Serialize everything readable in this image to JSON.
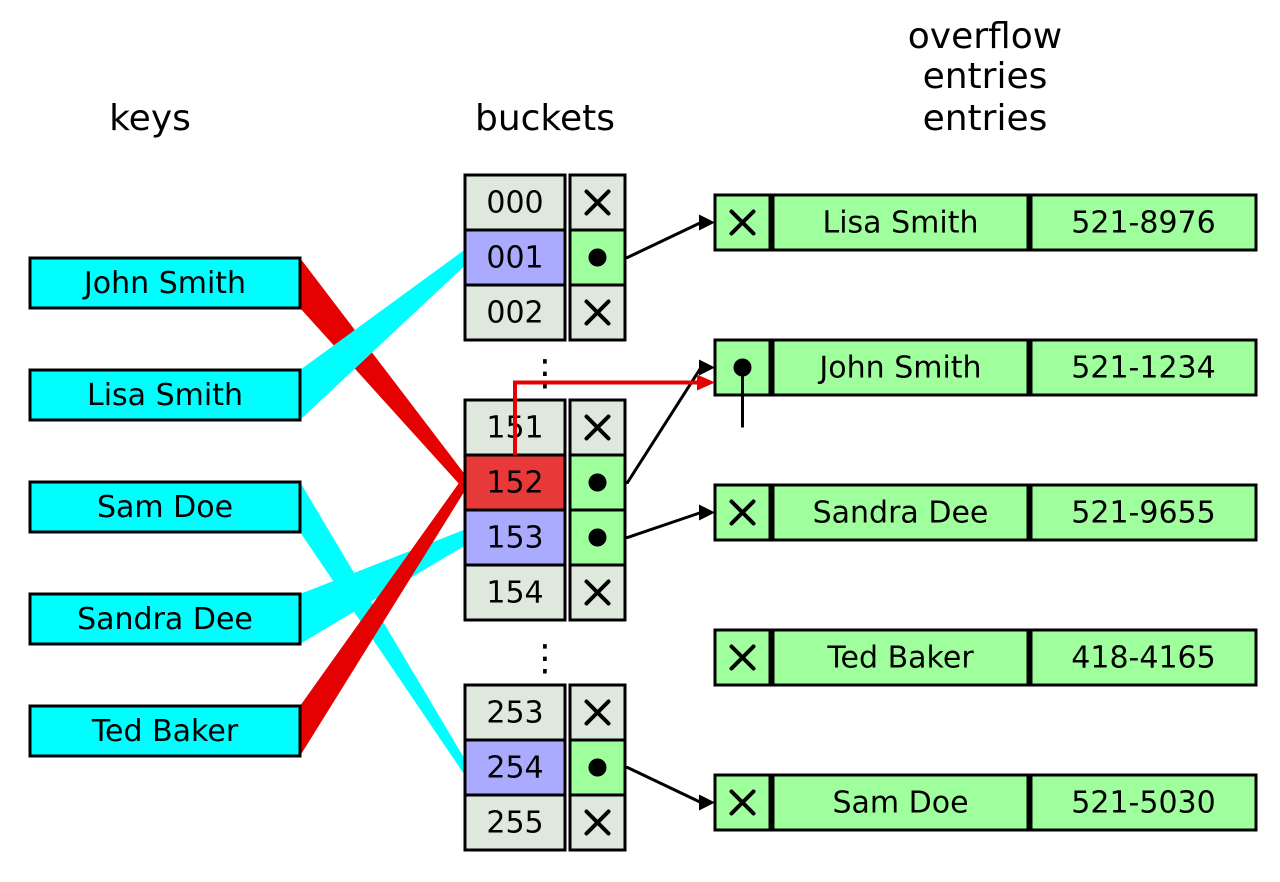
{
  "headers": {
    "keys": "keys",
    "buckets": "buckets",
    "entries": "entries",
    "overflow": "overflow\nentries"
  },
  "keys": [
    "John Smith",
    "Lisa Smith",
    "Sam Doe",
    "Sandra Dee",
    "Ted Baker"
  ],
  "buckets": [
    {
      "idx": "000",
      "state": "empty"
    },
    {
      "idx": "001",
      "state": "used"
    },
    {
      "idx": "002",
      "state": "empty"
    },
    {
      "idx": "151",
      "state": "empty"
    },
    {
      "idx": "152",
      "state": "overflow"
    },
    {
      "idx": "153",
      "state": "used"
    },
    {
      "idx": "154",
      "state": "empty"
    },
    {
      "idx": "253",
      "state": "empty"
    },
    {
      "idx": "254",
      "state": "used"
    },
    {
      "idx": "255",
      "state": "empty"
    }
  ],
  "entries": [
    {
      "name": "Lisa Smith",
      "phone": "521-8976",
      "prev": false
    },
    {
      "name": "John Smith",
      "phone": "521-1234",
      "prev": true
    },
    {
      "name": "Sandra Dee",
      "phone": "521-9655",
      "prev": false
    },
    {
      "name": "Ted Baker",
      "phone": "418-4165",
      "prev": false
    },
    {
      "name": "Sam Doe",
      "phone": "521-5030",
      "prev": false
    }
  ],
  "colors": {
    "key": "#00feff",
    "slot_empty": "#dfe8dc",
    "slot_used": "#aaaaff",
    "slot_overflow": "#e73939",
    "entry": "#9eff9c",
    "overflow": "#e50101"
  }
}
